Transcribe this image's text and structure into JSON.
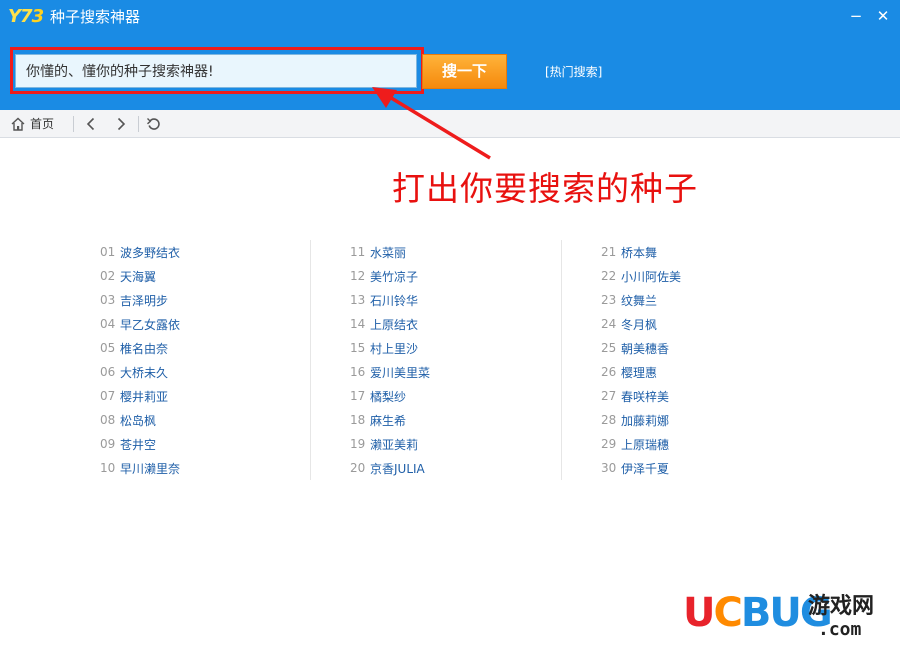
{
  "app": {
    "logo_text_a": "Y7",
    "logo_text_b": "3",
    "title": "种子搜索神器",
    "minimize_symbol": "−",
    "close_symbol": "✕"
  },
  "search": {
    "value": "你懂的、懂你的种子搜索神器!",
    "button_label": "搜一下",
    "hot_search_label": "[热门搜索]"
  },
  "nav": {
    "home_label": "首页",
    "icons": [
      "home-icon",
      "back-icon",
      "forward-icon",
      "refresh-icon"
    ]
  },
  "annotation": {
    "text": "打出你要搜索的种子",
    "color": "#e8110f"
  },
  "lists": {
    "col1": [
      {
        "num": "01",
        "name": "波多野结衣"
      },
      {
        "num": "02",
        "name": "天海翼"
      },
      {
        "num": "03",
        "name": "吉泽明步"
      },
      {
        "num": "04",
        "name": "早乙女露依"
      },
      {
        "num": "05",
        "name": "椎名由奈"
      },
      {
        "num": "06",
        "name": "大桥未久"
      },
      {
        "num": "07",
        "name": "樱井莉亚"
      },
      {
        "num": "08",
        "name": "松岛枫"
      },
      {
        "num": "09",
        "name": "苍井空"
      },
      {
        "num": "10",
        "name": "早川濑里奈"
      }
    ],
    "col2": [
      {
        "num": "11",
        "name": "水菜丽"
      },
      {
        "num": "12",
        "name": "美竹凉子"
      },
      {
        "num": "13",
        "name": "石川铃华"
      },
      {
        "num": "14",
        "name": "上原结衣"
      },
      {
        "num": "15",
        "name": "村上里沙"
      },
      {
        "num": "16",
        "name": "爱川美里菜"
      },
      {
        "num": "17",
        "name": "橘梨纱"
      },
      {
        "num": "18",
        "name": "麻生希"
      },
      {
        "num": "19",
        "name": "濑亚美莉"
      },
      {
        "num": "20",
        "name": "京香JULIA"
      }
    ],
    "col3": [
      {
        "num": "21",
        "name": "桥本舞"
      },
      {
        "num": "22",
        "name": "小川阿佐美"
      },
      {
        "num": "23",
        "name": "纹舞兰"
      },
      {
        "num": "24",
        "name": "冬月枫"
      },
      {
        "num": "25",
        "name": "朝美穗香"
      },
      {
        "num": "26",
        "name": "樱理惠"
      },
      {
        "num": "27",
        "name": "春咲梓美"
      },
      {
        "num": "28",
        "name": "加藤莉娜"
      },
      {
        "num": "29",
        "name": "上原瑞穗"
      },
      {
        "num": "30",
        "name": "伊泽千夏"
      }
    ]
  },
  "watermark": {
    "u": "U",
    "c": "C",
    "bug": "BUG",
    "cn": "游戏网",
    "com": ".com"
  },
  "colors": {
    "titlebar": "#1a8be4",
    "accent_orange": "#f5890c",
    "link_blue": "#1f5fa8"
  }
}
